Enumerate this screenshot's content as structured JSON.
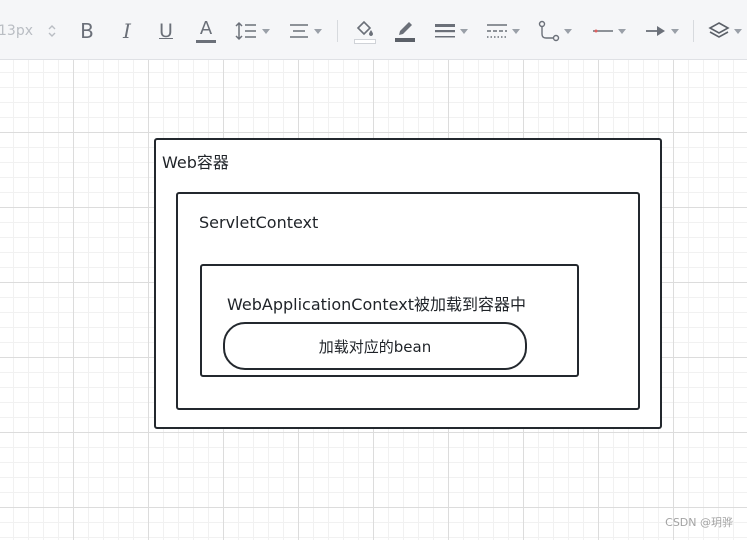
{
  "toolbar": {
    "font_size": "13px",
    "items": [
      {
        "name": "font-size-stepper"
      },
      {
        "name": "bold",
        "label": "B"
      },
      {
        "name": "italic",
        "label": "I"
      },
      {
        "name": "underline",
        "label": "U"
      },
      {
        "name": "font-color",
        "label": "A"
      },
      {
        "name": "line-height"
      },
      {
        "name": "align"
      },
      {
        "name": "fill-color"
      },
      {
        "name": "line-color"
      },
      {
        "name": "line-width"
      },
      {
        "name": "line-style"
      },
      {
        "name": "connector-type"
      },
      {
        "name": "line-start"
      },
      {
        "name": "line-end"
      },
      {
        "name": "layers"
      }
    ]
  },
  "diagram": {
    "outer_label": "Web容器",
    "middle_label": "ServletContext",
    "inner_label": "WebApplicationContext被加载到容器中",
    "pill_label": "加载对应的bean"
  },
  "watermark": "CSDN @玥骅",
  "colors": {
    "toolbar_bg": "#f5f6f8",
    "icon": "#6b7079",
    "border": "#23282e",
    "grid": "#dcdcdc"
  }
}
